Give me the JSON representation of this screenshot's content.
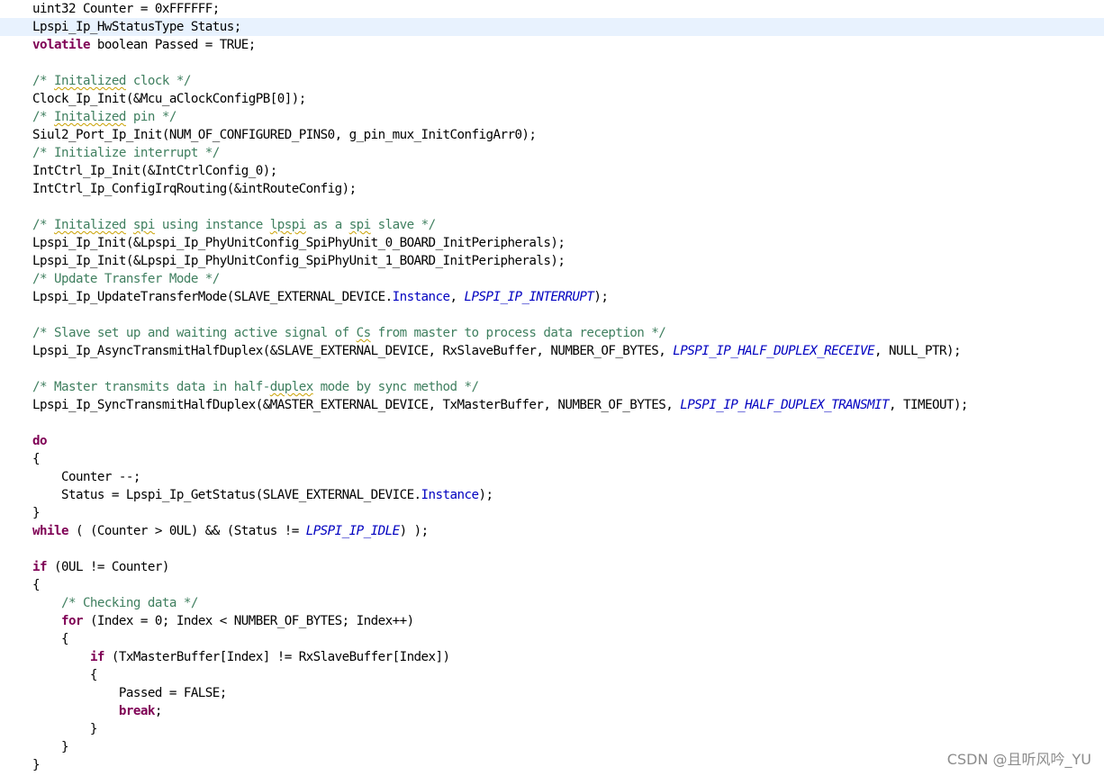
{
  "editor": {
    "current_line_index": 1,
    "colors": {
      "keyword": "#7f0055",
      "comment": "#3f7f5f",
      "field": "#0000c0",
      "enum": "#0000c0",
      "plain": "#000000",
      "current_line": "#e8f2fe",
      "spelling_underline": "#c8a000"
    },
    "lines": [
      [
        {
          "t": "plain",
          "s": "uint32 Counter = 0xFFFFFF;"
        }
      ],
      [
        {
          "t": "plain",
          "s": "Lpspi_Ip_HwStatusType Status;"
        }
      ],
      [
        {
          "t": "kw",
          "s": "volatile"
        },
        {
          "t": "plain",
          "s": " boolean Passed = TRUE;"
        }
      ],
      [],
      [
        {
          "t": "cm",
          "s": "/* "
        },
        {
          "t": "cm",
          "s": "Initalized",
          "sp": true
        },
        {
          "t": "cm",
          "s": " clock */"
        }
      ],
      [
        {
          "t": "plain",
          "s": "Clock_Ip_Init(&Mcu_aClockConfigPB[0]);"
        }
      ],
      [
        {
          "t": "cm",
          "s": "/* "
        },
        {
          "t": "cm",
          "s": "Initalized",
          "sp": true
        },
        {
          "t": "cm",
          "s": " pin */"
        }
      ],
      [
        {
          "t": "plain",
          "s": "Siul2_Port_Ip_Init(NUM_OF_CONFIGURED_PINS0, g_pin_mux_InitConfigArr0);"
        }
      ],
      [
        {
          "t": "cm",
          "s": "/* Initialize interrupt */"
        }
      ],
      [
        {
          "t": "plain",
          "s": "IntCtrl_Ip_Init(&IntCtrlConfig_0);"
        }
      ],
      [
        {
          "t": "plain",
          "s": "IntCtrl_Ip_ConfigIrqRouting(&intRouteConfig);"
        }
      ],
      [],
      [
        {
          "t": "cm",
          "s": "/* "
        },
        {
          "t": "cm",
          "s": "Initalized",
          "sp": true
        },
        {
          "t": "cm",
          "s": " "
        },
        {
          "t": "cm",
          "s": "spi",
          "sp": true
        },
        {
          "t": "cm",
          "s": " using instance "
        },
        {
          "t": "cm",
          "s": "lpspi",
          "sp": true
        },
        {
          "t": "cm",
          "s": " as a "
        },
        {
          "t": "cm",
          "s": "spi",
          "sp": true
        },
        {
          "t": "cm",
          "s": " slave */"
        }
      ],
      [
        {
          "t": "plain",
          "s": "Lpspi_Ip_Init(&Lpspi_Ip_PhyUnitConfig_SpiPhyUnit_0_BOARD_InitPeripherals);"
        }
      ],
      [
        {
          "t": "plain",
          "s": "Lpspi_Ip_Init(&Lpspi_Ip_PhyUnitConfig_SpiPhyUnit_1_BOARD_InitPeripherals);"
        }
      ],
      [
        {
          "t": "cm",
          "s": "/* Update Transfer Mode */"
        }
      ],
      [
        {
          "t": "plain",
          "s": "Lpspi_Ip_UpdateTransferMode(SLAVE_EXTERNAL_DEVICE."
        },
        {
          "t": "field",
          "s": "Instance"
        },
        {
          "t": "plain",
          "s": ", "
        },
        {
          "t": "enum",
          "s": "LPSPI_IP_INTERRUPT"
        },
        {
          "t": "plain",
          "s": ");"
        }
      ],
      [],
      [
        {
          "t": "cm",
          "s": "/* Slave set up and waiting active signal of "
        },
        {
          "t": "cm",
          "s": "Cs",
          "sp": true
        },
        {
          "t": "cm",
          "s": " from master to process data reception */"
        }
      ],
      [
        {
          "t": "plain",
          "s": "Lpspi_Ip_AsyncTransmitHalfDuplex(&SLAVE_EXTERNAL_DEVICE, RxSlaveBuffer, NUMBER_OF_BYTES, "
        },
        {
          "t": "enum",
          "s": "LPSPI_IP_HALF_DUPLEX_RECEIVE"
        },
        {
          "t": "plain",
          "s": ", NULL_PTR);"
        }
      ],
      [],
      [
        {
          "t": "cm",
          "s": "/* Master transmits data in half-"
        },
        {
          "t": "cm",
          "s": "duplex",
          "sp": true
        },
        {
          "t": "cm",
          "s": " mode by sync method */"
        }
      ],
      [
        {
          "t": "plain",
          "s": "Lpspi_Ip_SyncTransmitHalfDuplex(&MASTER_EXTERNAL_DEVICE, TxMasterBuffer, NUMBER_OF_BYTES, "
        },
        {
          "t": "enum",
          "s": "LPSPI_IP_HALF_DUPLEX_TRANSMIT"
        },
        {
          "t": "plain",
          "s": ", TIMEOUT);"
        }
      ],
      [],
      [
        {
          "t": "kw",
          "s": "do"
        }
      ],
      [
        {
          "t": "plain",
          "s": "{"
        }
      ],
      [
        {
          "t": "plain",
          "s": "    Counter --;"
        }
      ],
      [
        {
          "t": "plain",
          "s": "    Status = Lpspi_Ip_GetStatus(SLAVE_EXTERNAL_DEVICE."
        },
        {
          "t": "field",
          "s": "Instance"
        },
        {
          "t": "plain",
          "s": ");"
        }
      ],
      [
        {
          "t": "plain",
          "s": "}"
        }
      ],
      [
        {
          "t": "kw",
          "s": "while"
        },
        {
          "t": "plain",
          "s": " ( (Counter > 0UL) && (Status != "
        },
        {
          "t": "enum",
          "s": "LPSPI_IP_IDLE"
        },
        {
          "t": "plain",
          "s": ") );"
        }
      ],
      [],
      [
        {
          "t": "kw",
          "s": "if"
        },
        {
          "t": "plain",
          "s": " (0UL != Counter)"
        }
      ],
      [
        {
          "t": "plain",
          "s": "{"
        }
      ],
      [
        {
          "t": "plain",
          "s": "    "
        },
        {
          "t": "cm",
          "s": "/* Checking data */"
        }
      ],
      [
        {
          "t": "plain",
          "s": "    "
        },
        {
          "t": "kw",
          "s": "for"
        },
        {
          "t": "plain",
          "s": " (Index = 0; Index < NUMBER_OF_BYTES; Index++)"
        }
      ],
      [
        {
          "t": "plain",
          "s": "    {"
        }
      ],
      [
        {
          "t": "plain",
          "s": "        "
        },
        {
          "t": "kw",
          "s": "if"
        },
        {
          "t": "plain",
          "s": " (TxMasterBuffer[Index] != RxSlaveBuffer[Index])"
        }
      ],
      [
        {
          "t": "plain",
          "s": "        {"
        }
      ],
      [
        {
          "t": "plain",
          "s": "            Passed = FALSE;"
        }
      ],
      [
        {
          "t": "plain",
          "s": "            "
        },
        {
          "t": "kw",
          "s": "break"
        },
        {
          "t": "plain",
          "s": ";"
        }
      ],
      [
        {
          "t": "plain",
          "s": "        }"
        }
      ],
      [
        {
          "t": "plain",
          "s": "    }"
        }
      ],
      [
        {
          "t": "plain",
          "s": "}"
        }
      ]
    ]
  },
  "watermark": {
    "text": "CSDN @且听风吟_YU"
  }
}
